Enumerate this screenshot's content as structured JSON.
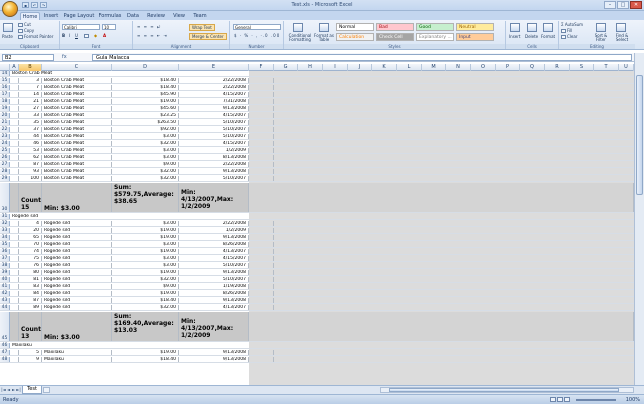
{
  "window": {
    "title": "Test.xls - Microsoft Excel",
    "controls": [
      "–",
      "□",
      "✕"
    ]
  },
  "qat": [
    "save",
    "undo",
    "redo"
  ],
  "tabs": [
    "Home",
    "Insert",
    "Page Layout",
    "Formulas",
    "Data",
    "Review",
    "View",
    "Team"
  ],
  "ribbon": {
    "clipboard": {
      "paste": "Paste",
      "cut": "Cut",
      "copy": "Copy",
      "format_painter": "Format Painter",
      "label": "Clipboard"
    },
    "font": {
      "name": "Calibri",
      "size": "10",
      "label": "Font"
    },
    "alignment": {
      "wrap": "Wrap Text",
      "merge": "Merge & Center",
      "label": "Alignment"
    },
    "number": {
      "format": "General",
      "label": "Number"
    },
    "styles": {
      "cond": "Conditional Formatting",
      "table": "Format as Table",
      "cells": [
        {
          "text": "Normal",
          "bg": "#ffffff",
          "fg": "#000000"
        },
        {
          "text": "Bad",
          "bg": "#ffc7ce",
          "fg": "#9c0006"
        },
        {
          "text": "Good",
          "bg": "#c6efce",
          "fg": "#006100"
        },
        {
          "text": "Neutral",
          "bg": "#ffeb9c",
          "fg": "#9c6500"
        },
        {
          "text": "Calculation",
          "bg": "#f2f2f2",
          "fg": "#fa7d00"
        },
        {
          "text": "Check Cell",
          "bg": "#a5a5a5",
          "fg": "#ffffff"
        },
        {
          "text": "Explanatory ...",
          "bg": "#ffffff",
          "fg": "#7f7f7f"
        },
        {
          "text": "Input",
          "bg": "#ffcc99",
          "fg": "#3f3f76"
        }
      ],
      "label": "Styles"
    },
    "cells_group": {
      "insert": "Insert",
      "delete": "Delete",
      "format": "Format",
      "label": "Cells"
    },
    "editing": {
      "autosum": "AutoSum",
      "fill": "Fill",
      "clear": "Clear",
      "sort": "Sort & Filter",
      "find": "Find & Select",
      "label": "Editing"
    }
  },
  "formula_bar": {
    "name_box": "B2",
    "fx": "fx",
    "formula": "Gula Malacca"
  },
  "columns": [
    "A",
    "B",
    "C",
    "D",
    "E",
    "F",
    "G",
    "H",
    "I",
    "J",
    "K",
    "L",
    "M",
    "N",
    "O",
    "P",
    "Q",
    "R",
    "S",
    "T",
    "U"
  ],
  "rows": [
    {
      "n": "14",
      "kind": "header",
      "text": "Boston Crab Meat"
    },
    {
      "n": "15",
      "kind": "data",
      "b": "3",
      "c": "Boston Crab Meat",
      "d": "$18.40",
      "e": "2/22/2008"
    },
    {
      "n": "16",
      "kind": "data",
      "b": "7",
      "c": "Boston Crab Meat",
      "d": "$18.40",
      "e": "2/22/2008"
    },
    {
      "n": "17",
      "kind": "data",
      "b": "14",
      "c": "Boston Crab Meat",
      "d": "$45.90",
      "e": "4/15/2007"
    },
    {
      "n": "18",
      "kind": "data",
      "b": "21",
      "c": "Boston Crab Meat",
      "d": "$19.00",
      "e": "7/31/2008"
    },
    {
      "n": "19",
      "kind": "data",
      "b": "27",
      "c": "Boston Crab Meat",
      "d": "$45.60",
      "e": "9/13/2008"
    },
    {
      "n": "20",
      "kind": "data",
      "b": "33",
      "c": "Boston Crab Meat",
      "d": "$23.25",
      "e": "4/15/2007"
    },
    {
      "n": "21",
      "kind": "data",
      "b": "35",
      "c": "Boston Crab Meat",
      "d": "$263.50",
      "e": "5/10/2007"
    },
    {
      "n": "22",
      "kind": "data",
      "b": "37",
      "c": "Boston Crab Meat",
      "d": "$92.00",
      "e": "5/10/2007"
    },
    {
      "n": "23",
      "kind": "data",
      "b": "44",
      "c": "Boston Crab Meat",
      "d": "$3.00",
      "e": "5/10/2007"
    },
    {
      "n": "24",
      "kind": "data",
      "b": "46",
      "c": "Boston Crab Meat",
      "d": "$32.00",
      "e": "4/15/2007"
    },
    {
      "n": "25",
      "kind": "data",
      "b": "53",
      "c": "Boston Crab Meat",
      "d": "$3.00",
      "e": "1/2/2009"
    },
    {
      "n": "26",
      "kind": "data",
      "b": "62",
      "c": "Boston Crab Meat",
      "d": "$3.00",
      "e": "8/13/2008"
    },
    {
      "n": "27",
      "kind": "data",
      "b": "87",
      "c": "Boston Crab Meat",
      "d": "$9.00",
      "e": "2/22/2008"
    },
    {
      "n": "28",
      "kind": "data",
      "b": "93",
      "c": "Boston Crab Meat",
      "d": "$32.00",
      "e": "9/13/2008"
    },
    {
      "n": "29",
      "kind": "data",
      "b": "100",
      "c": "Boston Crab Meat",
      "d": "$32.00",
      "e": "5/10/2007"
    },
    {
      "n": "30",
      "kind": "summary",
      "b1": "Count:",
      "b2": "15",
      "c": "Min: $3.00",
      "d1": "Sum:",
      "d2": "$579.75,Average:",
      "d3": "$38.65",
      "e1": "Min: 4/13/2007,Max:",
      "e2": "1/2/2009"
    },
    {
      "n": "31",
      "kind": "header",
      "text": "Rogede sild"
    },
    {
      "n": "32",
      "kind": "data",
      "b": "4",
      "c": "Rogede sild",
      "d": "$3.00",
      "e": "2/22/2008"
    },
    {
      "n": "33",
      "kind": "data",
      "b": "20",
      "c": "Rogede sild",
      "d": "$19.00",
      "e": "1/2/2009"
    },
    {
      "n": "34",
      "kind": "data",
      "b": "65",
      "c": "Rogede sild",
      "d": "$19.00",
      "e": "9/13/2008"
    },
    {
      "n": "35",
      "kind": "data",
      "b": "70",
      "c": "Rogede sild",
      "d": "$3.00",
      "e": "8/26/2008"
    },
    {
      "n": "36",
      "kind": "data",
      "b": "74",
      "c": "Rogede sild",
      "d": "$19.00",
      "e": "4/13/2007"
    },
    {
      "n": "37",
      "kind": "data",
      "b": "75",
      "c": "Rogede sild",
      "d": "$3.00",
      "e": "4/15/2007"
    },
    {
      "n": "38",
      "kind": "data",
      "b": "76",
      "c": "Rogede sild",
      "d": "$3.00",
      "e": "5/10/2007"
    },
    {
      "n": "39",
      "kind": "data",
      "b": "80",
      "c": "Rogede sild",
      "d": "$19.00",
      "e": "9/13/2008"
    },
    {
      "n": "40",
      "kind": "data",
      "b": "81",
      "c": "Rogede sild",
      "d": "$32.00",
      "e": "5/10/2007"
    },
    {
      "n": "41",
      "kind": "data",
      "b": "83",
      "c": "Rogede sild",
      "d": "$9.00",
      "e": "1/19/2008"
    },
    {
      "n": "42",
      "kind": "data",
      "b": "84",
      "c": "Rogede sild",
      "d": "$19.00",
      "e": "8/26/2008"
    },
    {
      "n": "43",
      "kind": "data",
      "b": "87",
      "c": "Rogede sild",
      "d": "$18.40",
      "e": "9/13/2008"
    },
    {
      "n": "44",
      "kind": "data",
      "b": "89",
      "c": "Rogede sild",
      "d": "$32.00",
      "e": "4/13/2007"
    },
    {
      "n": "45",
      "kind": "summary",
      "b1": "Count:",
      "b2": "13",
      "c": "Min: $3.00",
      "d1": "Sum:",
      "d2": "$169.40,Average:",
      "d3": "$13.03",
      "e1": "Min: 4/13/2007,Max:",
      "e2": "1/2/2009"
    },
    {
      "n": "46",
      "kind": "header",
      "text": "Maxilaku"
    },
    {
      "n": "47",
      "kind": "data",
      "b": "5",
      "c": "Maxilaku",
      "d": "$19.00",
      "e": "9/13/2008"
    },
    {
      "n": "48",
      "kind": "data",
      "b": "9",
      "c": "Maxilaku",
      "d": "$18.40",
      "e": "9/13/2008"
    }
  ],
  "sheet_tabs": {
    "nav": [
      "|◄",
      "◄",
      "►",
      "►|"
    ],
    "sheet": "Test"
  },
  "status": {
    "text": "Ready",
    "zoom": "100%"
  }
}
